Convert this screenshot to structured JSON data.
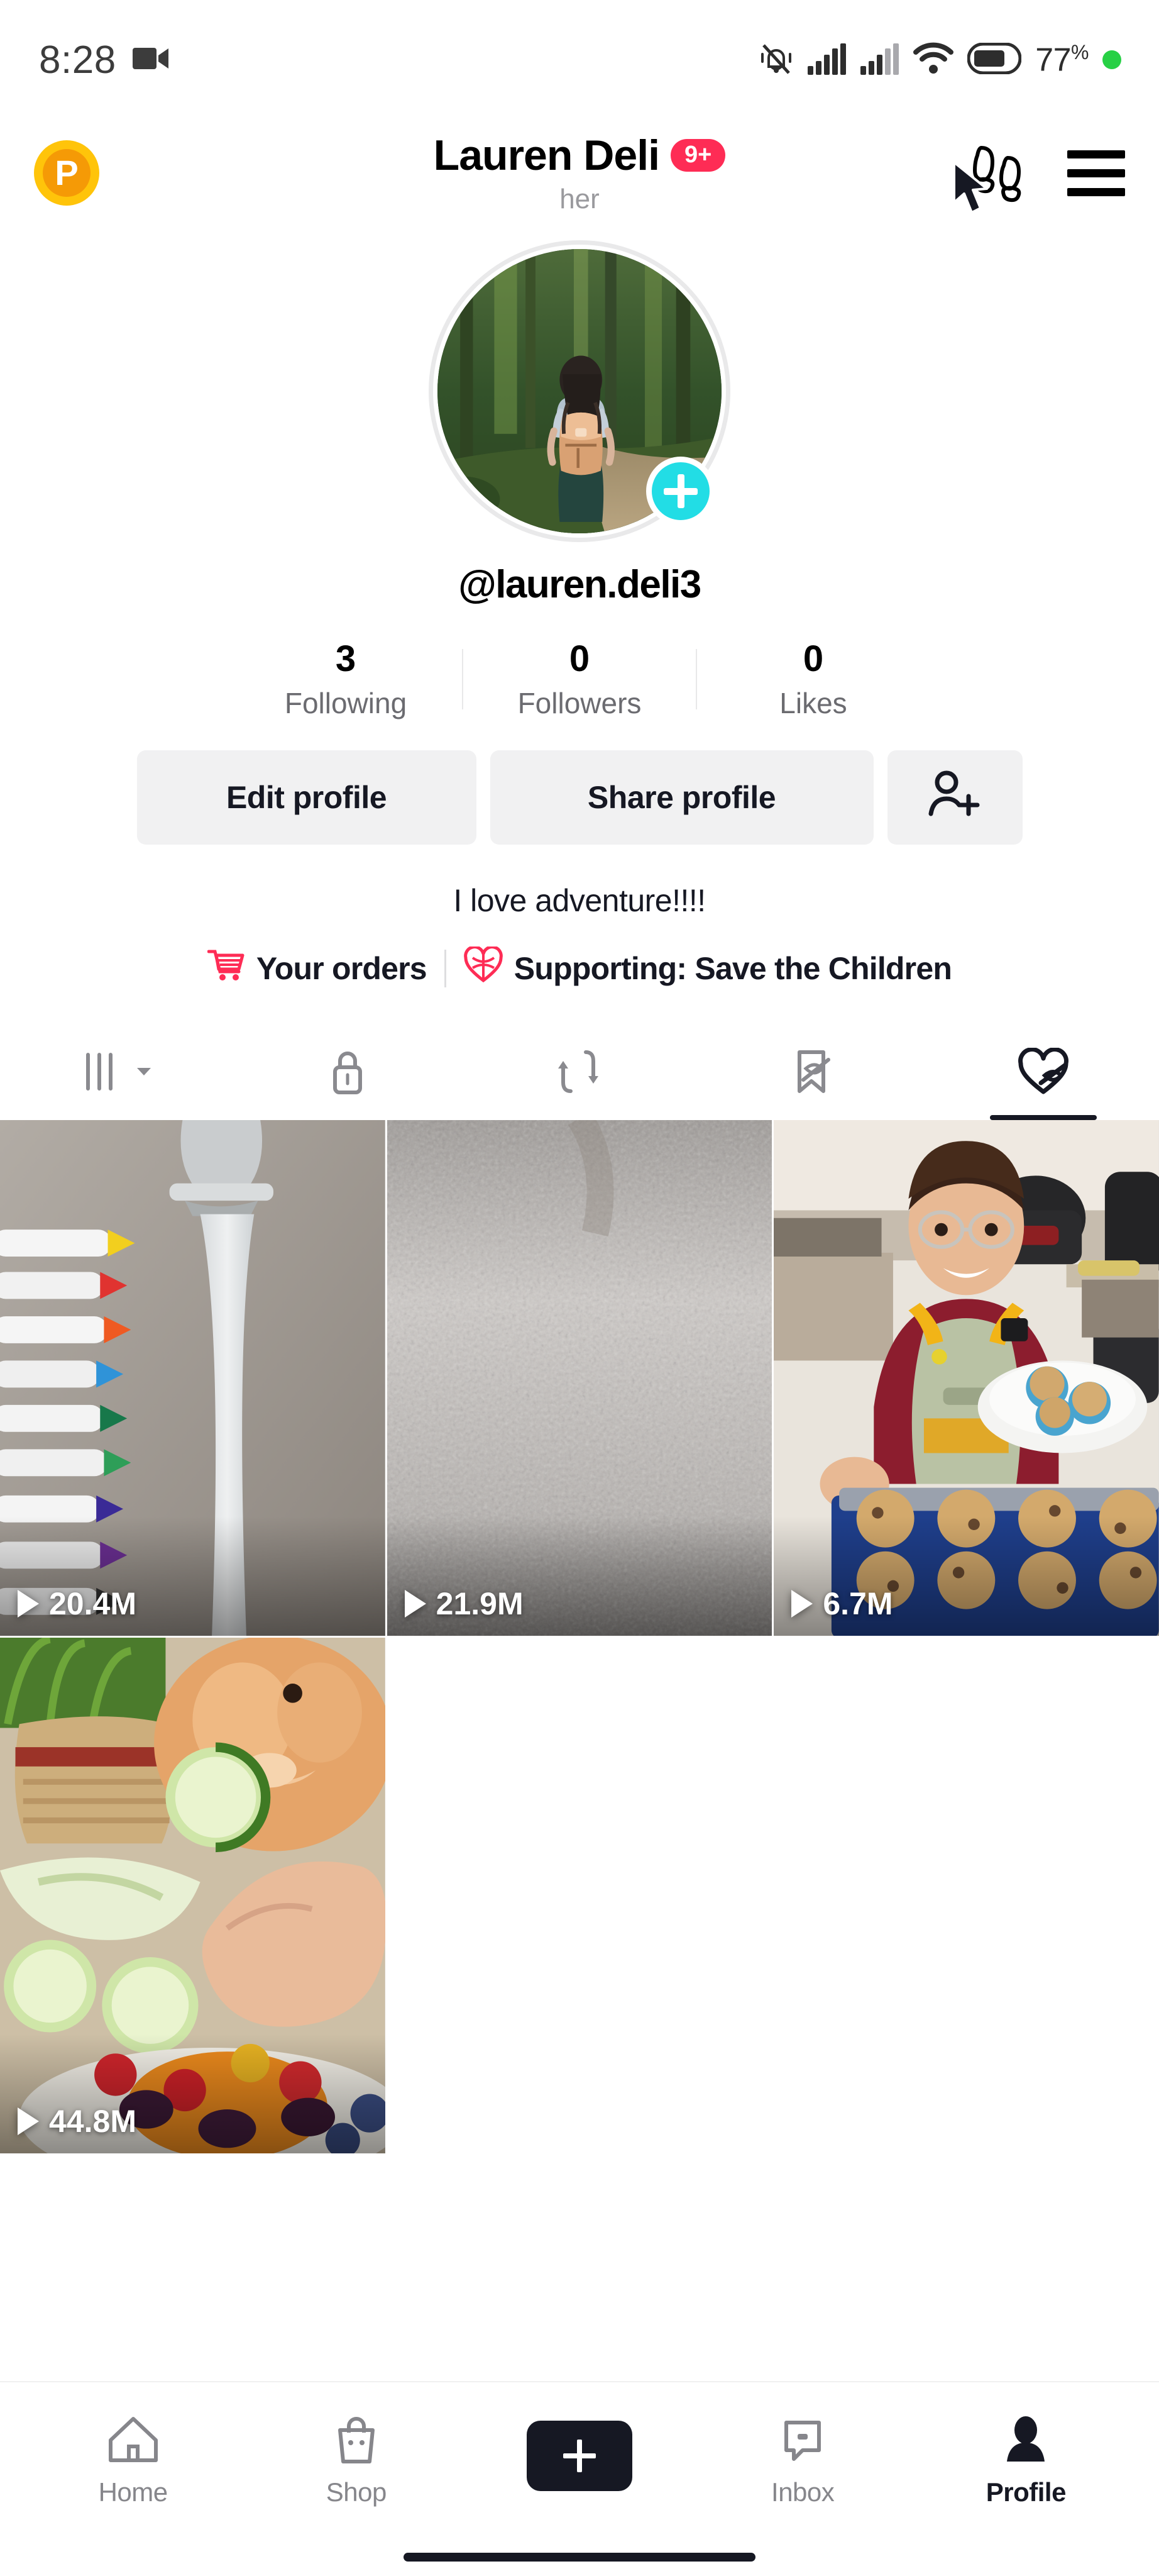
{
  "status_bar": {
    "time": "8:28",
    "video_icon": "video-camera-icon",
    "icons": [
      "bell-mute-icon",
      "signal-bars-icon",
      "signal-bars-2-icon",
      "wifi-icon",
      "battery-icon"
    ],
    "battery_percent": "77",
    "percent_symbol": "%",
    "recording_dot": "green-dot"
  },
  "header": {
    "badge_letter": "P",
    "title": "Lauren Deli",
    "notification_badge": "9+",
    "pronoun": "her",
    "friends_icon": "footsteps-friends-icon",
    "menu_icon": "hamburger-menu-icon",
    "cursor": "mouse-cursor"
  },
  "profile": {
    "avatar_alt": "hiker-with-backpack-in-forest",
    "add_story_label": "+",
    "handle": "@lauren.deli3",
    "stats": [
      {
        "num": "3",
        "label": "Following"
      },
      {
        "num": "0",
        "label": "Followers"
      },
      {
        "num": "0",
        "label": "Likes"
      }
    ],
    "buttons": {
      "edit": "Edit profile",
      "share": "Share profile",
      "add_friend_icon": "add-person-icon"
    },
    "bio": "I love adventure!!!!",
    "orders_label": "Your orders",
    "orders_icon": "shopping-cart-icon",
    "supporting_label": "Supporting: Save the Children",
    "supporting_icon": "charity-heart-icon"
  },
  "tabs": [
    {
      "name": "posts-grid",
      "icon": "grid-bars-icon",
      "has_caret": true,
      "active": false
    },
    {
      "name": "private",
      "icon": "lock-icon",
      "has_caret": false,
      "active": false
    },
    {
      "name": "reposts",
      "icon": "repost-arrows-icon",
      "has_caret": false,
      "active": false
    },
    {
      "name": "saved",
      "icon": "bookmark-slash-icon",
      "has_caret": false,
      "active": false
    },
    {
      "name": "liked",
      "icon": "heart-slash-icon",
      "has_caret": false,
      "active": true
    }
  ],
  "videos": [
    {
      "id": "v1",
      "views": "20.4M",
      "alt": "colored-markers-and-running-faucet"
    },
    {
      "id": "v2",
      "views": "21.9M",
      "alt": "grey-textured-surface"
    },
    {
      "id": "v3",
      "views": "6.7M",
      "alt": "woman-in-apron-holding-plate-of-muffins"
    },
    {
      "id": "v4",
      "views": "44.8M",
      "alt": "rabbit-eating-cucumber-slice"
    }
  ],
  "bottom_nav": [
    {
      "label": "Home",
      "icon": "home-icon",
      "active": false
    },
    {
      "label": "Shop",
      "icon": "shopping-bag-icon",
      "active": false
    },
    {
      "label": "",
      "icon": "create-plus-button",
      "active": false
    },
    {
      "label": "Inbox",
      "icon": "inbox-message-icon",
      "active": false
    },
    {
      "label": "Profile",
      "icon": "person-icon",
      "active": true
    }
  ],
  "colors": {
    "accent_pink": "#fe2c55",
    "accent_cyan": "#22dde5",
    "text_primary": "#161823",
    "text_muted": "#86868b",
    "button_bg": "#f1f1f2",
    "badge_orange": "#f59a06"
  }
}
